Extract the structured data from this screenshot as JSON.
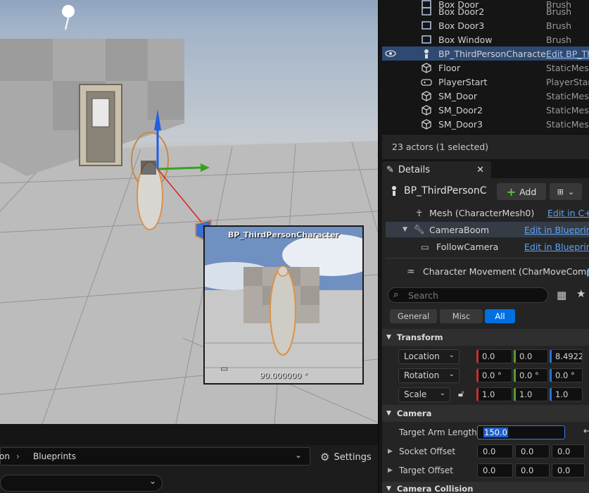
{
  "viewport": {
    "preview_title": "BP_ThirdPersonCharacter",
    "preview_angle": "90.000000 °"
  },
  "content_browser": {
    "breadcrumb_prev": "on",
    "breadcrumb_current": "Blueprints",
    "settings_label": "Settings"
  },
  "outliner": {
    "rows": [
      {
        "name": "Box Door",
        "type": "Brush",
        "icon": "brush-icon"
      },
      {
        "name": "Box Door2",
        "type": "Brush",
        "icon": "brush-icon"
      },
      {
        "name": "Box Door3",
        "type": "Brush",
        "icon": "brush-icon"
      },
      {
        "name": "Box Window",
        "type": "Brush",
        "icon": "brush-icon"
      },
      {
        "name": "BP_ThirdPersonCharacte",
        "type": "Edit BP_Thi",
        "icon": "skeleton-icon",
        "selected": true
      },
      {
        "name": "Floor",
        "type": "StaticMesh",
        "icon": "cube-icon"
      },
      {
        "name": "PlayerStart",
        "type": "PlayerStar",
        "icon": "gamepad-icon"
      },
      {
        "name": "SM_Door",
        "type": "StaticMesh",
        "icon": "cube-icon"
      },
      {
        "name": "SM_Door2",
        "type": "StaticMesh",
        "icon": "cube-icon"
      },
      {
        "name": "SM_Door3",
        "type": "StaticMesh",
        "icon": "cube-icon"
      }
    ],
    "actor_count": "23 actors (1 selected)"
  },
  "details": {
    "tab_label": "Details",
    "object_name": "BP_ThirdPersonC",
    "add_label": "Add",
    "components": [
      {
        "name": "Mesh (CharacterMesh0)",
        "link": "Edit in C++"
      },
      {
        "name": "CameraBoom",
        "link": "Edit in Blueprint"
      },
      {
        "name": "FollowCamera",
        "link": "Edit in Blueprint"
      },
      {
        "name": "Character Movement (CharMoveComp)",
        "link": "E"
      }
    ],
    "search_placeholder": "Search",
    "filters": [
      "General",
      "Misc",
      "All"
    ],
    "active_filter": "All",
    "transform": {
      "section_label": "Transform",
      "location_label": "Location",
      "location": [
        "0.0",
        "0.0",
        "8.4922"
      ],
      "rotation_label": "Rotation",
      "rotation": [
        "0.0 °",
        "0.0 °",
        "0.0 °"
      ],
      "scale_label": "Scale",
      "scale": [
        "1.0",
        "1.0",
        "1.0"
      ]
    },
    "camera": {
      "section_label": "Camera",
      "target_arm_length_label": "Target Arm Length",
      "target_arm_length": "150.0",
      "socket_offset_label": "Socket Offset",
      "socket_offset": [
        "0.0",
        "0.0",
        "0.0"
      ],
      "target_offset_label": "Target Offset",
      "target_offset": [
        "0.0",
        "0.0",
        "0.0"
      ]
    },
    "camera_collision_label": "Camera Collision"
  },
  "colors": {
    "accent": "#0070e0",
    "selection": "#2e4a72",
    "link": "#5fa3f5"
  }
}
